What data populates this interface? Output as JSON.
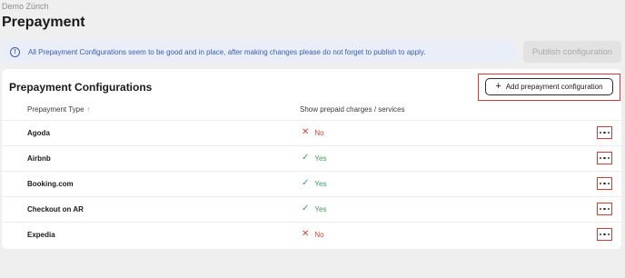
{
  "header": {
    "breadcrumb": "Demo Zürich",
    "title": "Prepayment"
  },
  "banner": {
    "icon": "info-icon",
    "text": "All Prepayment Configurations seem to be good and in place, after making changes please do not forget to publish to apply."
  },
  "publish_button": {
    "label": "Publish configuration",
    "state": "disabled"
  },
  "section": {
    "title": "Prepayment Configurations",
    "add_button": {
      "label": "Add prepayment configuration",
      "icon": "plus-icon"
    }
  },
  "table": {
    "columns": [
      {
        "label": "Prepayment Type",
        "sort_icon": "arrow-up-icon"
      },
      {
        "label": "Show prepaid charges / services"
      }
    ],
    "rows": [
      {
        "name": "Agoda",
        "status": "No",
        "status_icon": "cross-icon"
      },
      {
        "name": "Airbnb",
        "status": "Yes",
        "status_icon": "check-icon"
      },
      {
        "name": "Booking.com",
        "status": "Yes",
        "status_icon": "check-icon"
      },
      {
        "name": "Checkout on AR",
        "status": "Yes",
        "status_icon": "check-icon"
      },
      {
        "name": "Expedia",
        "status": "No",
        "status_icon": "cross-icon"
      }
    ]
  },
  "colors": {
    "yes": "#3a9a5a",
    "no": "#d93a2b",
    "highlight": "#d93a2b",
    "info": "#3b5dab"
  }
}
